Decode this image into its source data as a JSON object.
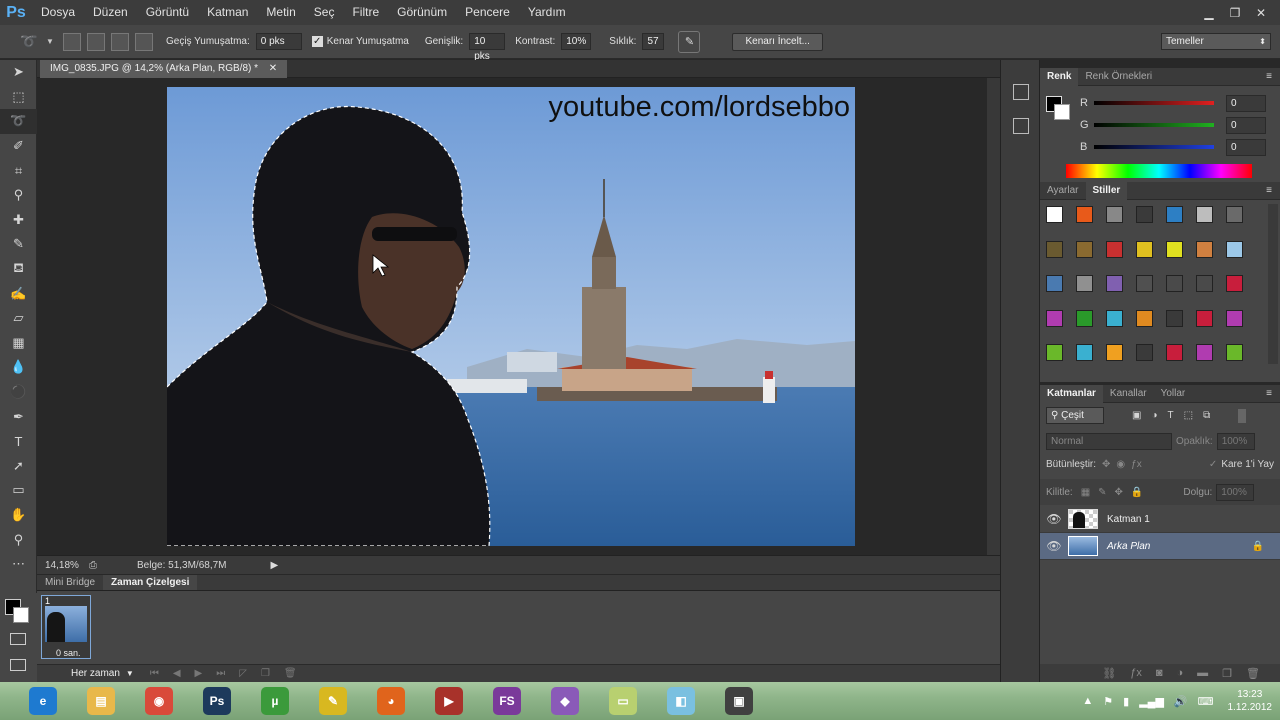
{
  "app": {
    "logo": "Ps"
  },
  "menu": [
    "Dosya",
    "Düzen",
    "Görüntü",
    "Katman",
    "Metin",
    "Seç",
    "Filtre",
    "Görünüm",
    "Pencere",
    "Yardım"
  ],
  "options": {
    "feather_label": "Geçiş Yumuşatma:",
    "feather_value": "0 pks",
    "antialias_label": "Kenar Yumuşatma",
    "width_label": "Genişlik:",
    "width_value": "10 pks",
    "contrast_label": "Kontrast:",
    "contrast_value": "10%",
    "frequency_label": "Sıklık:",
    "frequency_value": "57",
    "refine_button": "Kenarı İncelt...",
    "workspace": "Temeller"
  },
  "document": {
    "tab_title": "IMG_0835.JPG @ 14,2% (Arka Plan, RGB/8) *",
    "watermark": "youtube.com/lordsebbo",
    "zoom": "14,18%",
    "doc_info": "Belge: 51,3M/68,7M"
  },
  "timeline": {
    "tabs": [
      "Mini Bridge",
      "Zaman Çizelgesi"
    ],
    "frame_number": "1",
    "frame_delay": "0 san.",
    "loop": "Her zaman"
  },
  "color_panel": {
    "tabs": [
      "Renk",
      "Renk Örnekleri"
    ],
    "channels": [
      {
        "label": "R",
        "value": "0",
        "color": "#e02020"
      },
      {
        "label": "G",
        "value": "0",
        "color": "#20b020"
      },
      {
        "label": "B",
        "value": "0",
        "color": "#2040e0"
      }
    ]
  },
  "styles_panel": {
    "tabs": [
      "Ayarlar",
      "Stiller"
    ],
    "swatches": [
      "#ffffff",
      "#e85a1a",
      "#888888",
      "#3a3a3a",
      "#2d7fc4",
      "#bdbdbd",
      "#6a6a6a",
      "#6a5a30",
      "#8a6a30",
      "#c83030",
      "#e0c020",
      "#e0e020",
      "#d08040",
      "#9cc8e8",
      "#4a7ab0",
      "#909090",
      "#8060b0",
      "#505050",
      "#4a4a4a",
      "#4a4a4a",
      "#c81e3c",
      "#b03cb0",
      "#2a9a2a",
      "#3ab0d0",
      "#e08a20",
      "#3a3a3a",
      "#c81e3c",
      "#b03cb0",
      "#6ab82a",
      "#3ab0d0",
      "#f0a020",
      "#3a3a3a",
      "#c81e3c",
      "#b03cb0",
      "#6ab82a"
    ]
  },
  "layers_panel": {
    "tabs": [
      "Katmanlar",
      "Kanallar",
      "Yollar"
    ],
    "filter": "Çeşit",
    "blend_mode": "Normal",
    "opacity_label": "Opaklık:",
    "opacity_value": "100%",
    "unify_label": "Bütünleştir:",
    "propagate_label": "Kare 1'i Yay",
    "lock_label": "Kilitle:",
    "fill_label": "Dolgu:",
    "fill_value": "100%",
    "layers": [
      {
        "name": "Katman 1",
        "selected": false
      },
      {
        "name": "Arka Plan",
        "selected": true
      }
    ]
  },
  "taskbar": {
    "apps": [
      {
        "icon": "internet-explorer-icon",
        "glyph": "e",
        "color": "#1e7ad0"
      },
      {
        "icon": "file-explorer-icon",
        "glyph": "▤",
        "color": "#e8b84a"
      },
      {
        "icon": "chrome-icon",
        "glyph": "◉",
        "color": "#d94a3a"
      },
      {
        "icon": "photoshop-icon",
        "glyph": "Ps",
        "color": "#1d3a5c"
      },
      {
        "icon": "utorrent-icon",
        "glyph": "µ",
        "color": "#3b9a3b"
      },
      {
        "icon": "notes-icon",
        "glyph": "✎",
        "color": "#d8b820"
      },
      {
        "icon": "firefox-icon",
        "glyph": "◕",
        "color": "#e0641c"
      },
      {
        "icon": "media-app-icon",
        "glyph": "▶",
        "color": "#a8322a"
      },
      {
        "icon": "fs-app-icon",
        "glyph": "FS",
        "color": "#7a3a9a"
      },
      {
        "icon": "crystal-app-icon",
        "glyph": "◆",
        "color": "#8a5ab8"
      },
      {
        "icon": "sticky-notes-icon",
        "glyph": "▭",
        "color": "#b8d070"
      },
      {
        "icon": "sketch-app-icon",
        "glyph": "◧",
        "color": "#7ac0e0"
      },
      {
        "icon": "camera-app-icon",
        "glyph": "▣",
        "color": "#404040"
      }
    ],
    "time": "13:23",
    "date": "1.12.2012"
  }
}
